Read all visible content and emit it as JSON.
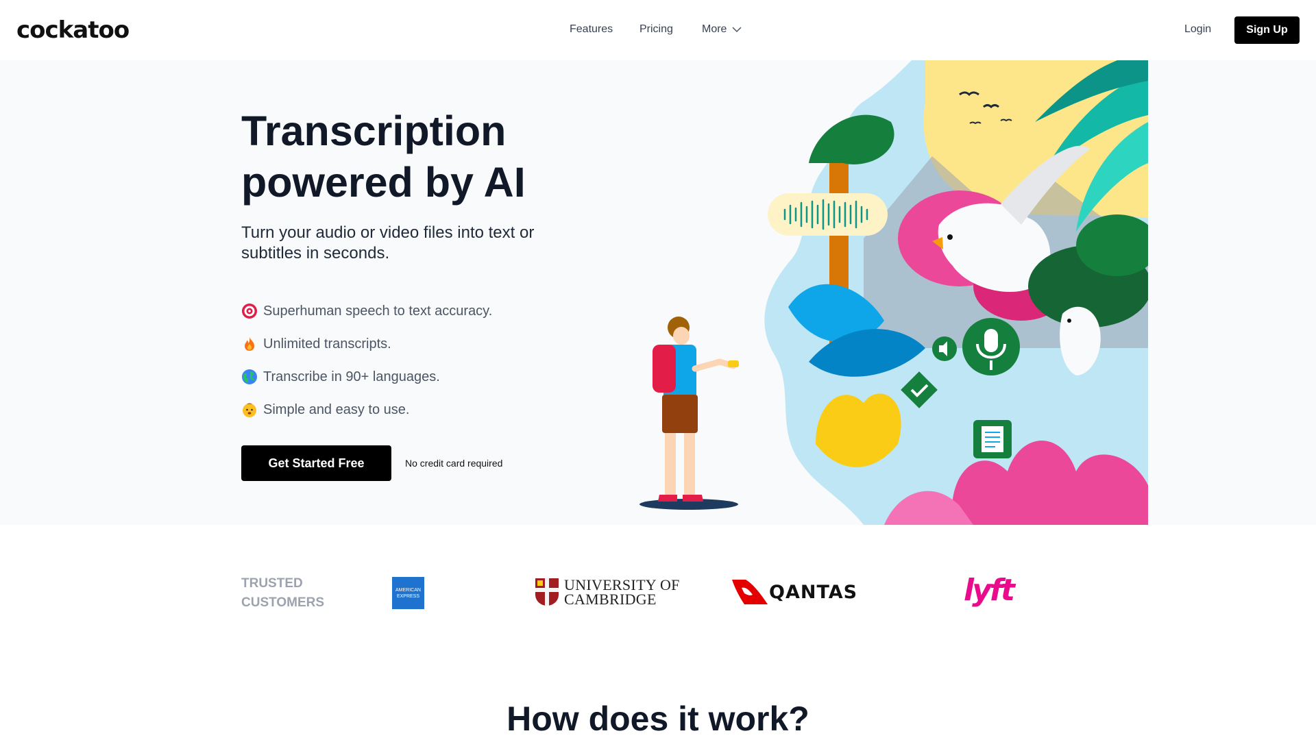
{
  "header": {
    "logo": "cockatoo",
    "nav": {
      "features": "Features",
      "pricing": "Pricing",
      "more": "More"
    },
    "login": "Login",
    "signup": "Sign Up"
  },
  "hero": {
    "title_line1": "Transcription",
    "title_line2": "powered by AI",
    "subtitle": "Turn your audio or video files into text or subtitles in seconds.",
    "features": [
      {
        "icon": "target-icon",
        "text": "Superhuman speech to text accuracy."
      },
      {
        "icon": "fire-icon",
        "text": "Unlimited transcripts."
      },
      {
        "icon": "globe-icon",
        "text": "Transcribe in 90+ languages."
      },
      {
        "icon": "baby-icon",
        "text": "Simple and easy to use."
      }
    ],
    "cta": "Get Started Free",
    "cta_note": "No credit card required"
  },
  "trusted": {
    "label_line1": "TRUSTED",
    "label_line2": "CUSTOMERS",
    "logos": {
      "amex": "AMERICAN EXPRESS",
      "cambridge_line1": "UNIVERSITY OF",
      "cambridge_line2": "CAMBRIDGE",
      "qantas": "QANTAS",
      "lyft": "lyft"
    }
  },
  "section2": {
    "title": "How does it work?"
  },
  "colors": {
    "brand_black": "#000000",
    "hero_bg": "#f8fafc",
    "lyft_pink": "#ea0b8c",
    "qantas_red": "#e40000",
    "amex_blue": "#1f72cd",
    "cambridge_red": "#a11d21"
  }
}
